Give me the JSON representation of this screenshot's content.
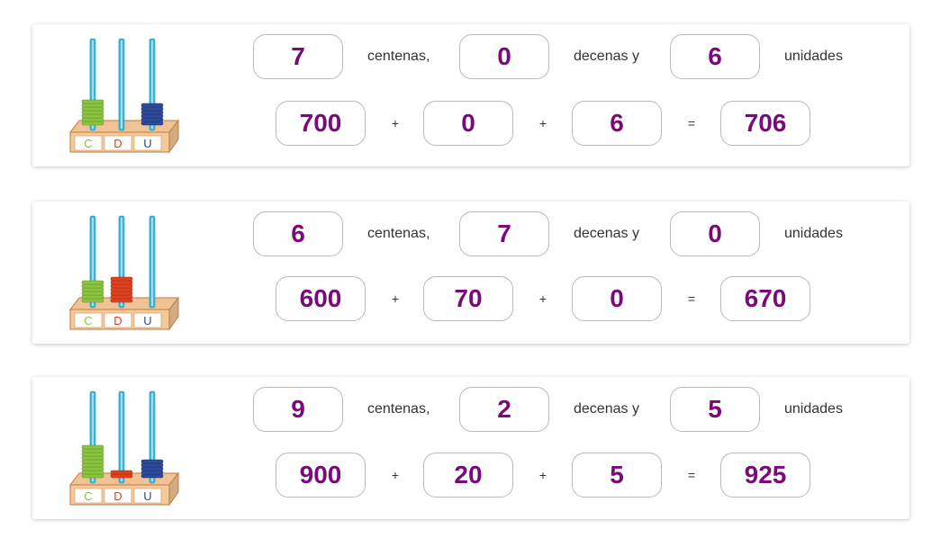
{
  "colors": {
    "value_text": "#7a0a7a",
    "centenas_beads": "#8cc63f",
    "decenas_beads": "#e0401e",
    "unidades_beads": "#2e4a9a",
    "rod": "#3ab8de",
    "abacus_base": "#f6c99a"
  },
  "rows": [
    {
      "abacus": {
        "labels": [
          "C",
          "D",
          "U"
        ],
        "beads": [
          7,
          0,
          6
        ]
      },
      "centenas": "7",
      "decenas": "0",
      "unidades": "6",
      "word_centenas": "centenas,",
      "word_decenas": "decenas y",
      "word_unidades": "unidades",
      "sum_c": "700",
      "sum_d": "0",
      "sum_u": "6",
      "total": "706",
      "plus1": "+",
      "plus2": "+",
      "equals": "="
    },
    {
      "abacus": {
        "labels": [
          "C",
          "D",
          "U"
        ],
        "beads": [
          6,
          7,
          0
        ]
      },
      "centenas": "6",
      "decenas": "7",
      "unidades": "0",
      "word_centenas": "centenas,",
      "word_decenas": "decenas y",
      "word_unidades": "unidades",
      "sum_c": "600",
      "sum_d": "70",
      "sum_u": "0",
      "total": "670",
      "plus1": "+",
      "plus2": "+",
      "equals": "="
    },
    {
      "abacus": {
        "labels": [
          "C",
          "D",
          "U"
        ],
        "beads": [
          9,
          2,
          5
        ]
      },
      "centenas": "9",
      "decenas": "2",
      "unidades": "5",
      "word_centenas": "centenas,",
      "word_decenas": "decenas y",
      "word_unidades": "unidades",
      "sum_c": "900",
      "sum_d": "20",
      "sum_u": "5",
      "total": "925",
      "plus1": "+",
      "plus2": "+",
      "equals": "="
    }
  ]
}
